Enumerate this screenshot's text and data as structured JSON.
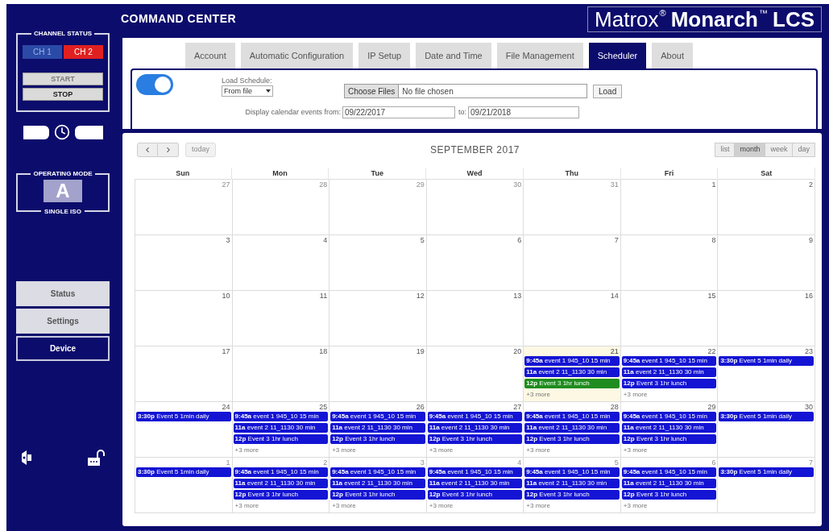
{
  "sidebar": {
    "channel_status": {
      "title": "CHANNEL STATUS",
      "channels": [
        {
          "label": "CH 1",
          "color": "#2b4aa6",
          "active": false
        },
        {
          "label": "CH 2",
          "color": "#e02020",
          "active": true
        }
      ],
      "controls": [
        {
          "label": "START",
          "disabled": true
        },
        {
          "label": "STOP",
          "disabled": false
        }
      ]
    },
    "operating_mode": {
      "title": "OPERATING MODE",
      "mode": "A",
      "caption": "SINGLE ISO"
    },
    "nav": [
      {
        "label": "Status",
        "selected": false
      },
      {
        "label": "Settings",
        "selected": false
      },
      {
        "label": "Device",
        "selected": true
      }
    ]
  },
  "header": {
    "title": "COMMAND CENTER",
    "brand": "Matrox$^{®}$ **Monarch**$^{™}$ **LCS**"
  },
  "tabs": [
    {
      "label": "Account",
      "selected": false
    },
    {
      "label": "Automatic Configuration",
      "selected": false
    },
    {
      "label": "IP Setup",
      "selected": false
    },
    {
      "label": "Date and Time",
      "selected": false
    },
    {
      "label": "File Management",
      "selected": false
    },
    {
      "label": "Scheduler",
      "selected": true
    },
    {
      "label": "About",
      "selected": false
    }
  ],
  "scheduler": {
    "enabled": true,
    "load_schedule": {
      "label": "Load Schedule:",
      "value": "From file"
    },
    "file_input": {
      "button": "Choose Files",
      "status": "No file chosen"
    },
    "load_button": "Load",
    "range": {
      "label": "Display calendar events from:",
      "from": "09/22/2017",
      "to_label": "to:",
      "to": "09/21/2018"
    }
  },
  "calendar": {
    "today_button": {
      "label": "today",
      "disabled": true
    },
    "title": "SEPTEMBER 2017",
    "views": [
      {
        "label": "list",
        "selected": false
      },
      {
        "label": "month",
        "selected": true
      },
      {
        "label": "week",
        "selected": false
      },
      {
        "label": "day",
        "selected": false
      }
    ],
    "weekdays": [
      "Sun",
      "Mon",
      "Tue",
      "Wed",
      "Thu",
      "Fri",
      "Sat"
    ],
    "weeks": [
      {
        "days": [
          {
            "date": "27",
            "kind": "other"
          },
          {
            "date": "28",
            "kind": "other"
          },
          {
            "date": "29",
            "kind": "other"
          },
          {
            "date": "30",
            "kind": "other"
          },
          {
            "date": "31",
            "kind": "other"
          },
          {
            "date": "1",
            "kind": "current"
          },
          {
            "date": "2",
            "kind": "current"
          }
        ]
      },
      {
        "days": [
          {
            "date": "3",
            "kind": "current"
          },
          {
            "date": "4",
            "kind": "current"
          },
          {
            "date": "5",
            "kind": "current"
          },
          {
            "date": "6",
            "kind": "current"
          },
          {
            "date": "7",
            "kind": "current"
          },
          {
            "date": "8",
            "kind": "current"
          },
          {
            "date": "9",
            "kind": "current"
          }
        ]
      },
      {
        "days": [
          {
            "date": "10",
            "kind": "current"
          },
          {
            "date": "11",
            "kind": "current"
          },
          {
            "date": "12",
            "kind": "current"
          },
          {
            "date": "13",
            "kind": "current"
          },
          {
            "date": "14",
            "kind": "current"
          },
          {
            "date": "15",
            "kind": "current"
          },
          {
            "date": "16",
            "kind": "current"
          }
        ]
      },
      {
        "days": [
          {
            "date": "17",
            "kind": "current"
          },
          {
            "date": "18",
            "kind": "current"
          },
          {
            "date": "19",
            "kind": "current"
          },
          {
            "date": "20",
            "kind": "current"
          },
          {
            "date": "21",
            "kind": "today",
            "events": [
              {
                "time": "9:45a",
                "title": "event 1 945_10 15 min",
                "color": "#1414d4"
              },
              {
                "time": "11a",
                "title": "event 2 11_1130 30 min",
                "color": "#1414d4"
              },
              {
                "time": "12p",
                "title": "Event 3 1hr lunch",
                "color": "#1f8c1f"
              }
            ],
            "more": "+3 more"
          },
          {
            "date": "22",
            "kind": "current",
            "events": [
              {
                "time": "9:45a",
                "title": "event 1 945_10 15 min",
                "color": "#1414d4"
              },
              {
                "time": "11a",
                "title": "event 2 11_1130 30 min",
                "color": "#1414d4"
              },
              {
                "time": "12p",
                "title": "Event 3 1hr lunch",
                "color": "#1414d4"
              }
            ],
            "more": "+3 more"
          },
          {
            "date": "23",
            "kind": "current",
            "events": [
              {
                "time": "3:30p",
                "title": "Event 5 1min daily",
                "color": "#1414d4"
              }
            ]
          }
        ]
      },
      {
        "days": [
          {
            "date": "24",
            "kind": "current",
            "events": [
              {
                "time": "3:30p",
                "title": "Event 5 1min daily",
                "color": "#1414d4"
              }
            ]
          },
          {
            "date": "25",
            "kind": "current",
            "events": [
              {
                "time": "9:45a",
                "title": "event 1 945_10 15 min",
                "color": "#1414d4"
              },
              {
                "time": "11a",
                "title": "event 2 11_1130 30 min",
                "color": "#1414d4"
              },
              {
                "time": "12p",
                "title": "Event 3 1hr lunch",
                "color": "#1414d4"
              }
            ],
            "more": "+3 more"
          },
          {
            "date": "26",
            "kind": "current",
            "events": [
              {
                "time": "9:45a",
                "title": "event 1 945_10 15 min",
                "color": "#1414d4"
              },
              {
                "time": "11a",
                "title": "event 2 11_1130 30 min",
                "color": "#1414d4"
              },
              {
                "time": "12p",
                "title": "Event 3 1hr lunch",
                "color": "#1414d4"
              }
            ],
            "more": "+3 more"
          },
          {
            "date": "27",
            "kind": "current",
            "events": [
              {
                "time": "9:45a",
                "title": "event 1 945_10 15 min",
                "color": "#1414d4"
              },
              {
                "time": "11a",
                "title": "event 2 11_1130 30 min",
                "color": "#1414d4"
              },
              {
                "time": "12p",
                "title": "Event 3 1hr lunch",
                "color": "#1414d4"
              }
            ],
            "more": "+3 more"
          },
          {
            "date": "28",
            "kind": "current",
            "events": [
              {
                "time": "9:45a",
                "title": "event 1 945_10 15 min",
                "color": "#1414d4"
              },
              {
                "time": "11a",
                "title": "event 2 11_1130 30 min",
                "color": "#1414d4"
              },
              {
                "time": "12p",
                "title": "Event 3 1hr lunch",
                "color": "#1414d4"
              }
            ],
            "more": "+3 more"
          },
          {
            "date": "29",
            "kind": "current",
            "events": [
              {
                "time": "9:45a",
                "title": "event 1 945_10 15 min",
                "color": "#1414d4"
              },
              {
                "time": "11a",
                "title": "event 2 11_1130 30 min",
                "color": "#1414d4"
              },
              {
                "time": "12p",
                "title": "Event 3 1hr lunch",
                "color": "#1414d4"
              }
            ],
            "more": "+3 more"
          },
          {
            "date": "30",
            "kind": "current",
            "events": [
              {
                "time": "3:30p",
                "title": "Event 5 1min daily",
                "color": "#1414d4"
              }
            ]
          }
        ]
      },
      {
        "days": [
          {
            "date": "1",
            "kind": "other",
            "events": [
              {
                "time": "3:30p",
                "title": "Event 5 1min daily",
                "color": "#1414d4"
              }
            ]
          },
          {
            "date": "2",
            "kind": "other",
            "events": [
              {
                "time": "9:45a",
                "title": "event 1 945_10 15 min",
                "color": "#1414d4"
              },
              {
                "time": "11a",
                "title": "event 2 11_1130 30 min",
                "color": "#1414d4"
              },
              {
                "time": "12p",
                "title": "Event 3 1hr lunch",
                "color": "#1414d4"
              }
            ],
            "more": "+3 more"
          },
          {
            "date": "3",
            "kind": "other",
            "events": [
              {
                "time": "9:45a",
                "title": "event 1 945_10 15 min",
                "color": "#1414d4"
              },
              {
                "time": "11a",
                "title": "event 2 11_1130 30 min",
                "color": "#1414d4"
              },
              {
                "time": "12p",
                "title": "Event 3 1hr lunch",
                "color": "#1414d4"
              }
            ],
            "more": "+3 more"
          },
          {
            "date": "4",
            "kind": "other",
            "events": [
              {
                "time": "9:45a",
                "title": "event 1 945_10 15 min",
                "color": "#1414d4"
              },
              {
                "time": "11a",
                "title": "event 2 11_1130 30 min",
                "color": "#1414d4"
              },
              {
                "time": "12p",
                "title": "Event 3 1hr lunch",
                "color": "#1414d4"
              }
            ],
            "more": "+3 more"
          },
          {
            "date": "5",
            "kind": "other",
            "events": [
              {
                "time": "9:45a",
                "title": "event 1 945_10 15 min",
                "color": "#1414d4"
              },
              {
                "time": "11a",
                "title": "event 2 11_1130 30 min",
                "color": "#1414d4"
              },
              {
                "time": "12p",
                "title": "Event 3 1hr lunch",
                "color": "#1414d4"
              }
            ],
            "more": "+3 more"
          },
          {
            "date": "6",
            "kind": "other",
            "events": [
              {
                "time": "9:45a",
                "title": "event 1 945_10 15 min",
                "color": "#1414d4"
              },
              {
                "time": "11a",
                "title": "event 2 11_1130 30 min",
                "color": "#1414d4"
              },
              {
                "time": "12p",
                "title": "Event 3 1hr lunch",
                "color": "#1414d4"
              }
            ],
            "more": "+3 more"
          },
          {
            "date": "7",
            "kind": "other",
            "events": [
              {
                "time": "3:30p",
                "title": "Event 5 1min daily",
                "color": "#1414d4"
              }
            ]
          }
        ]
      }
    ]
  }
}
